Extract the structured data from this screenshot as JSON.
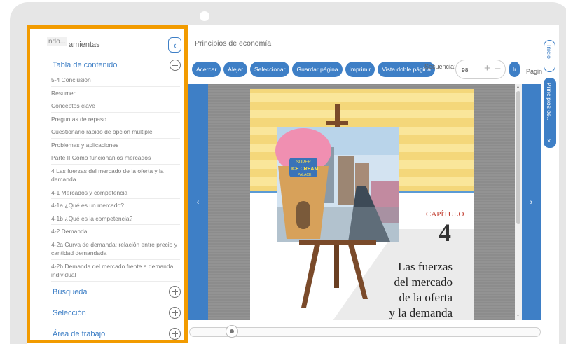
{
  "sidebar": {
    "search_text": "ndo...",
    "title": "amientas",
    "toc_title": "Tabla de contenido",
    "toc_items": [
      "5-4 Conclusión",
      "Resumen",
      "Conceptos clave",
      "Preguntas de repaso",
      "Cuestionario rápido de opción múltiple",
      "Problemas y aplicaciones",
      "Parte II Cómo funcionanlos mercados",
      "4 Las fuerzas del mercado de la oferta y la demanda",
      "4-1 Mercados y competencia",
      "4-1a ¿Qué es un mercado?",
      "4-1b ¿Qué es la competencia?",
      "4-2 Demanda",
      "4-2a Curva de demanda: relación entre precio y cantidad demandada",
      "4-2b Demanda del mercado frente a demanda individual"
    ],
    "sections": [
      "Búsqueda",
      "Selección",
      "Área de trabajo"
    ]
  },
  "header": {
    "book_title": "Principios de economía"
  },
  "toolbar": {
    "buttons": [
      "Acercar",
      "Alejar",
      "Seleccionar",
      "Guardar página",
      "Imprimir",
      "Vista doble página"
    ],
    "sequence_label": "Secuencia:",
    "sequence_value": "98",
    "go_label": "Ir",
    "page_label": "Págin"
  },
  "side_tabs": {
    "inicio": "Inicio",
    "principios": "Principios de...",
    "close": "×"
  },
  "book": {
    "chapter_label": "CAPÍTULO",
    "chapter_number": "4",
    "title_lines": [
      "Las fuerzas",
      "del mercado",
      "de la oferta",
      "y la demanda"
    ],
    "sign_lines": [
      "SUPER",
      "ICE CREAM",
      "PALACE"
    ]
  },
  "nav": {
    "prev": "‹",
    "next": "›"
  },
  "colors": {
    "accent": "#3e7fc6",
    "highlight_border": "#f29b00",
    "page_yellow": "#fae69a"
  }
}
